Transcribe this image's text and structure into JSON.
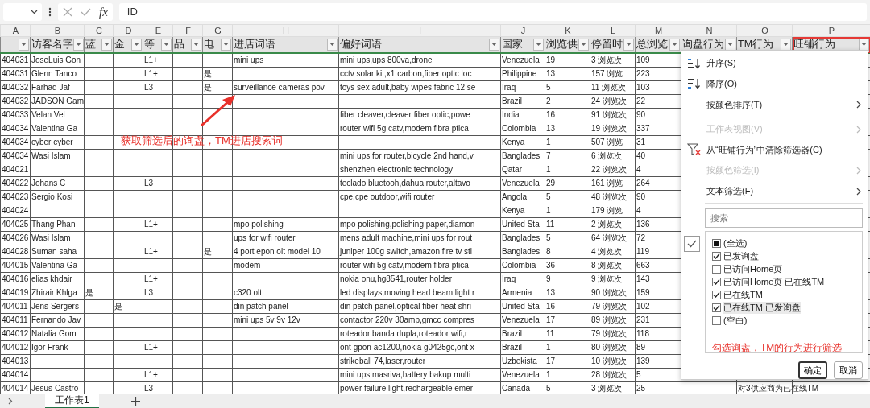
{
  "formula_bar": {
    "function_label": "fx",
    "formula": "ID"
  },
  "columns": [
    {
      "letter": "A"
    },
    {
      "letter": "B",
      "header": "访客名字"
    },
    {
      "letter": "C",
      "header": "蓝"
    },
    {
      "letter": "D",
      "header": "金"
    },
    {
      "letter": "E",
      "header": "等"
    },
    {
      "letter": "F",
      "header": "品"
    },
    {
      "letter": "G",
      "header": "电"
    },
    {
      "letter": "H",
      "header": "进店词语"
    },
    {
      "letter": "I",
      "header": "偏好词语"
    },
    {
      "letter": "J",
      "header": "国家"
    },
    {
      "letter": "K",
      "header": "浏览供"
    },
    {
      "letter": "L",
      "header": "停留时"
    },
    {
      "letter": "M",
      "header": "总浏览"
    },
    {
      "letter": "N",
      "header": "询盘行为"
    },
    {
      "letter": "O",
      "header": "TM行为"
    },
    {
      "letter": "P",
      "header": "旺铺行为",
      "highlighted": true
    }
  ],
  "rows": [
    {
      "A": "404031",
      "B": "JoseLuis Gon",
      "E": "L1+",
      "H": "mini ups",
      "I": "mini ups,ups 800va,drone",
      "J": "Venezuela",
      "K": "19",
      "L": "3 浏览次",
      "M": "109"
    },
    {
      "A": "404031",
      "B": "Glenn Tanco",
      "E": "L1+",
      "G": "是",
      "I": "cctv solar kit,x1 carbon,fiber optic loc",
      "J": "Philippine",
      "K": "13",
      "L": "157 浏览",
      "M": "223"
    },
    {
      "A": "404032",
      "B": "Farhad Jaf",
      "E": "L3",
      "G": "是",
      "H": "surveillance cameras pov",
      "I": "toys sex adult,baby wipes fabric 12 se",
      "J": "Iraq",
      "K": "5",
      "L": "11 浏览次",
      "M": "103"
    },
    {
      "A": "404032",
      "B": "JADSON Gam",
      "J": "Brazil",
      "K": "2",
      "L": "24 浏览次",
      "M": "22"
    },
    {
      "A": "404033",
      "B": "Velan Vel",
      "I": "fiber cleaver,cleaver fiber optic,powe",
      "J": "India",
      "K": "16",
      "L": "91 浏览次",
      "M": "90"
    },
    {
      "A": "404034",
      "B": "Valentina Ga",
      "I": "router wifi 5g catv,modem fibra ptica",
      "J": "Colombia",
      "K": "13",
      "L": "19 浏览次",
      "M": "337"
    },
    {
      "A": "404034",
      "B": "cyber cyber",
      "J": "Kenya",
      "K": "1",
      "L": "507 浏览",
      "M": "31"
    },
    {
      "A": "404034",
      "B": "Wasi Islam",
      "I": "mini ups for router,bicycle 2nd hand,v",
      "J": "Banglades",
      "K": "7",
      "L": "6 浏览次",
      "M": "40"
    },
    {
      "A": "404021",
      "I": "shenzhen electronic technology",
      "J": "Qatar",
      "K": "1",
      "L": "22 浏览次",
      "M": "4"
    },
    {
      "A": "404022",
      "B": "Johans C",
      "E": "L3",
      "I": "teclado bluetooh,dahua router,altavo",
      "J": "Venezuela",
      "K": "29",
      "L": "161 浏览",
      "M": "264"
    },
    {
      "A": "404023",
      "B": "Sergio Kosi",
      "I": "cpe,cpe outdoor,wifi router",
      "J": "Angola",
      "K": "5",
      "L": "48 浏览次",
      "M": "90"
    },
    {
      "A": "404024",
      "J": "Kenya",
      "K": "1",
      "L": "179 浏览",
      "M": "4"
    },
    {
      "A": "404025",
      "B": "Thang Phan",
      "E": "L1+",
      "H": "mpo polishing",
      "I": "mpo polishing,polishing paper,diamon",
      "J": "United Sta",
      "K": "11",
      "L": "2 浏览次",
      "M": "136"
    },
    {
      "A": "404026",
      "B": "Wasi Islam",
      "H": "ups for wifi router",
      "I": "mens adult machine,mini ups for rout",
      "J": "Banglades",
      "K": "5",
      "L": "64 浏览次",
      "M": "72"
    },
    {
      "A": "404028",
      "B": "Suman saha",
      "E": "L1+",
      "G": "是",
      "H": "4 port epon olt model 10",
      "I": "juniper 100g switch,amazon fire tv sti",
      "J": "Banglades",
      "K": "8",
      "L": "4 浏览次",
      "M": "119"
    },
    {
      "A": "404015",
      "B": "Valentina Ga",
      "H": "modem",
      "I": "router wifi 5g catv,modem fibra ptica",
      "J": "Colombia",
      "K": "36",
      "L": "8 浏览次",
      "M": "663"
    },
    {
      "A": "404016",
      "B": "elias khdair",
      "E": "L1+",
      "I": "nokia onu,hg8541,router holder",
      "J": "Iraq",
      "K": "9",
      "L": "9 浏览次",
      "M": "143"
    },
    {
      "A": "404019",
      "B": "Zhirair Khlga",
      "C": "是",
      "E": "L3",
      "H": "c320 olt",
      "I": "led displays,moving head beam light r",
      "J": "Armenia",
      "K": "13",
      "L": "90 浏览次",
      "M": "159"
    },
    {
      "A": "404011",
      "B": "Jens Sergers",
      "D": "是",
      "H": "din patch panel",
      "I": "din patch panel,optical fiber heat shri",
      "J": "United Sta",
      "K": "16",
      "L": "79 浏览次",
      "M": "102"
    },
    {
      "A": "404011",
      "B": "Fernando Jav",
      "H": "mini ups 5v 9v 12v",
      "I": "contactor 220v 30amp,gmcc compres",
      "J": "Venezuela",
      "K": "17",
      "L": "89 浏览次",
      "M": "231"
    },
    {
      "A": "404012",
      "B": "Natalia Gom",
      "I": "roteador banda dupla,roteador wifi,r",
      "J": "Brazil",
      "K": "11",
      "L": "79 浏览次",
      "M": "118"
    },
    {
      "A": "404012",
      "B": "Igor Frank",
      "E": "L1+",
      "I": "ont gpon ac1200,nokia g0425gc,ont x",
      "J": "Brazil",
      "K": "1",
      "L": "80 浏览次",
      "M": "89"
    },
    {
      "A": "404013",
      "I": "strikeball 74,laser,router",
      "J": "Uzbekista",
      "K": "17",
      "L": "10 浏览次",
      "M": "139"
    },
    {
      "A": "404014",
      "E": "L1+",
      "I": "mini ups masriva,battery bakup multi",
      "J": "Venezuela",
      "K": "1",
      "L": "28 浏览次",
      "M": "5"
    },
    {
      "A": "404014",
      "B": "Jesus Castro",
      "E": "L3",
      "I": "power failure light,rechargeable emer",
      "J": "Canada",
      "K": "5",
      "L": "3 浏览次",
      "M": "25",
      "O": "对3供应商为已在线TM"
    }
  ],
  "annotation": "获取筛选后的询盘，TM进店搜索词",
  "filter_menu": {
    "items": [
      {
        "kind": "sort_asc",
        "label": "升序(S)",
        "disabled": false,
        "submenu": false
      },
      {
        "kind": "sort_desc",
        "label": "降序(O)",
        "disabled": false,
        "submenu": false
      },
      {
        "kind": "item",
        "label": "按颜色排序(T)",
        "disabled": false,
        "submenu": true
      },
      {
        "kind": "separator"
      },
      {
        "kind": "item",
        "label": "工作表视图(V)",
        "disabled": true,
        "submenu": true
      },
      {
        "kind": "clear_filter",
        "label": "从“旺铺行为”中清除筛选器(C)",
        "disabled": false,
        "submenu": false
      },
      {
        "kind": "item",
        "label": "按颜色筛选(I)",
        "disabled": true,
        "submenu": true
      },
      {
        "kind": "item",
        "label": "文本筛选(F)",
        "disabled": false,
        "submenu": true
      }
    ],
    "search_placeholder": "搜索",
    "values": [
      {
        "label": "(全选)",
        "checked": false,
        "partial": true,
        "selected": false
      },
      {
        "label": "已发询盘",
        "checked": true,
        "selected": false
      },
      {
        "label": "已访问Home页",
        "checked": false,
        "partial": false,
        "selected": false
      },
      {
        "label": "已访问Home页 已在线TM",
        "checked": true,
        "selected": false
      },
      {
        "label": "已在线TM",
        "checked": true,
        "selected": false
      },
      {
        "label": "已在线TM 已发询盘",
        "checked": true,
        "selected": true
      },
      {
        "label": "(空白)",
        "checked": false,
        "partial": false,
        "selected": false
      }
    ],
    "note": "勾选询盘，TM的行为进行筛选",
    "buttons": [
      {
        "label": "确定",
        "focused": true
      },
      {
        "label": "取消",
        "focused": false
      }
    ]
  },
  "sheet_tabs": [
    {
      "label": "工作表1",
      "selected": true
    }
  ]
}
